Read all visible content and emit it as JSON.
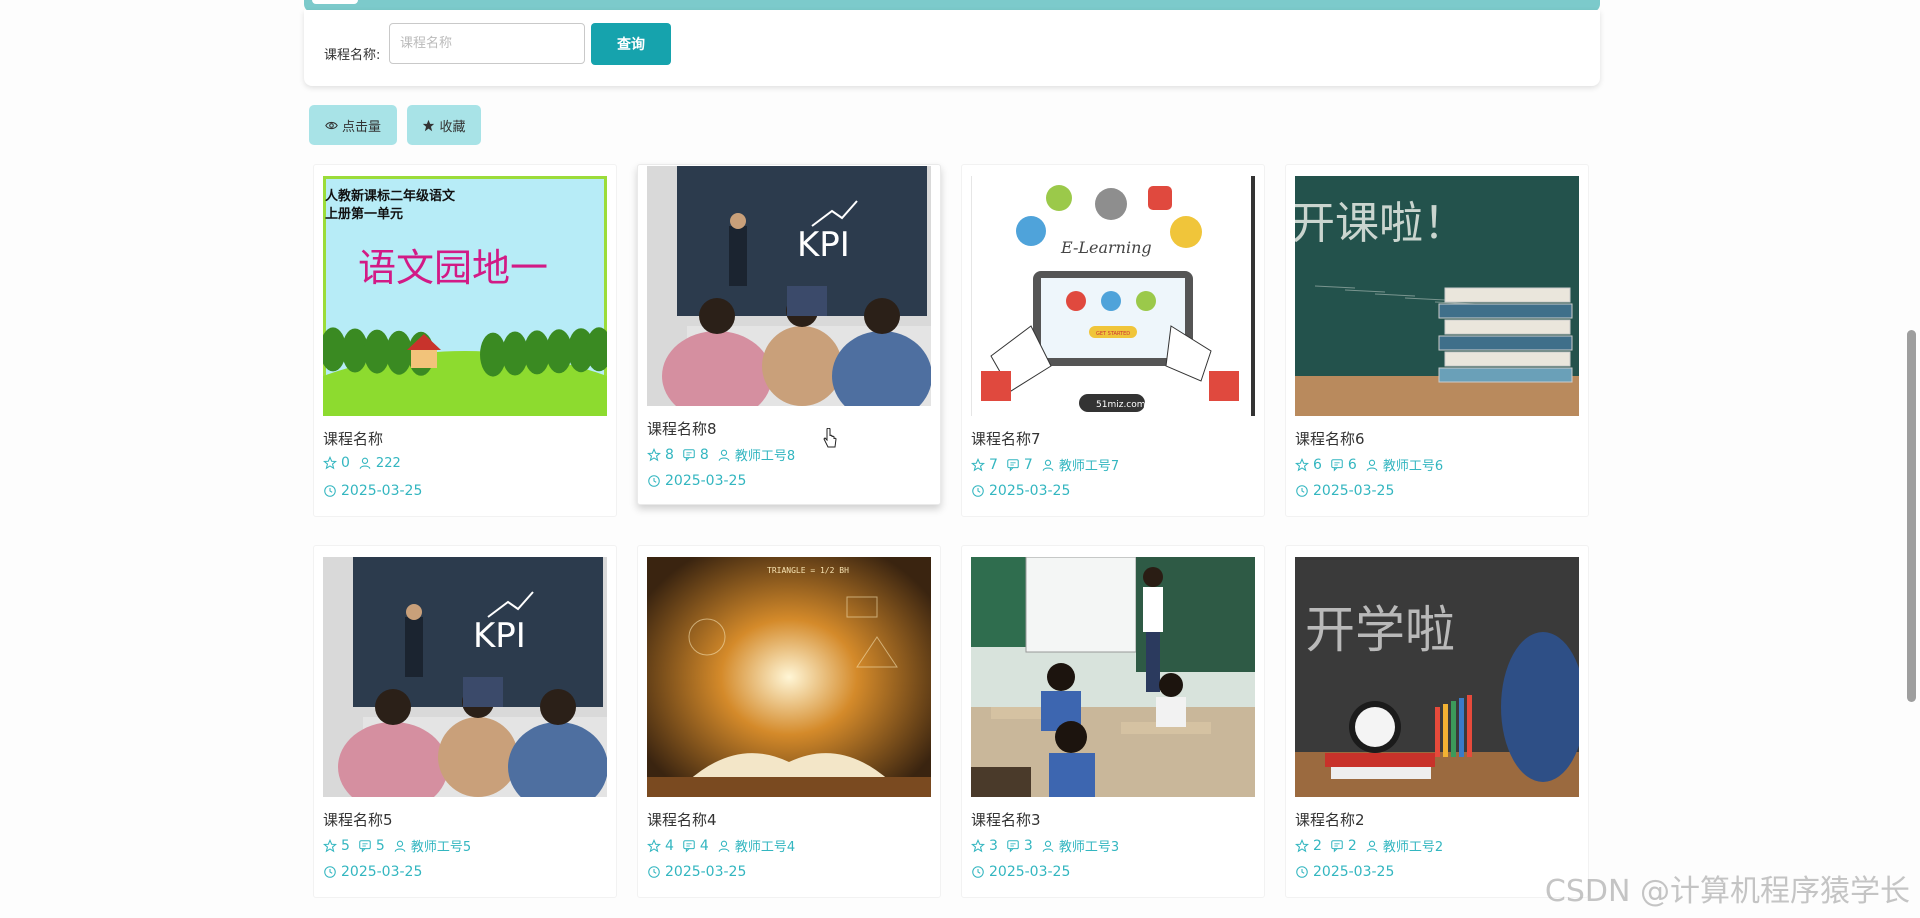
{
  "search": {
    "label": "课程名称:",
    "placeholder": "课程名称",
    "button_label": "查询"
  },
  "sort_buttons": {
    "views_label": "点击量",
    "favorites_label": "收藏"
  },
  "cards": [
    {
      "title": "课程名称",
      "favorites": "0",
      "comments": "",
      "teacher": "222",
      "date": "2025-03-25",
      "image": {
        "kind": "chinese",
        "line1": "人教新课标二年级语文",
        "line2": "上册第一单元",
        "big": "语文园地一"
      }
    },
    {
      "title": "课程名称8",
      "favorites": "8",
      "comments": "8",
      "teacher": "教师工号8",
      "date": "2025-03-25",
      "image": {
        "kind": "kpi",
        "text": "KPI"
      }
    },
    {
      "title": "课程名称7",
      "favorites": "7",
      "comments": "7",
      "teacher": "教师工号7",
      "date": "2025-03-25",
      "image": {
        "kind": "elearning",
        "text": "E-Learning",
        "button": "GET STARTED",
        "tag": "51miz.com"
      }
    },
    {
      "title": "课程名称6",
      "favorites": "6",
      "comments": "6",
      "teacher": "教师工号6",
      "date": "2025-03-25",
      "image": {
        "kind": "kaike",
        "text": "开课啦！"
      }
    },
    {
      "title": "课程名称5",
      "favorites": "5",
      "comments": "5",
      "teacher": "教师工号5",
      "date": "2025-03-25",
      "image": {
        "kind": "kpi",
        "text": "KPI"
      }
    },
    {
      "title": "课程名称4",
      "favorites": "4",
      "comments": "4",
      "teacher": "教师工号4",
      "date": "2025-03-25",
      "image": {
        "kind": "book",
        "text": "TRIANGLE = 1/2 BH"
      }
    },
    {
      "title": "课程名称3",
      "favorites": "3",
      "comments": "3",
      "teacher": "教师工号3",
      "date": "2025-03-25",
      "image": {
        "kind": "classroom"
      }
    },
    {
      "title": "课程名称2",
      "favorites": "2",
      "comments": "2",
      "teacher": "教师工号2",
      "date": "2025-03-25",
      "image": {
        "kind": "kaixue",
        "text": "开学啦"
      }
    }
  ],
  "watermark": "CSDN @计算机程序猿学长",
  "colors": {
    "accent": "#16a3ad",
    "meta": "#33b6c0",
    "sort_bg": "#a8e3e7"
  }
}
